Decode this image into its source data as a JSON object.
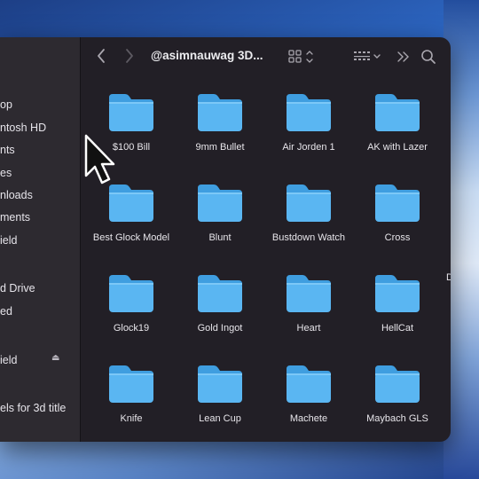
{
  "window": {
    "title": "@asimnauwag 3D..."
  },
  "sidebar": {
    "items": [
      {
        "label": "op"
      },
      {
        "label": "ntosh HD"
      },
      {
        "label": "nts"
      },
      {
        "label": "es"
      },
      {
        "label": "nloads"
      },
      {
        "label": "ments"
      },
      {
        "label": "ield"
      },
      {
        "label": "d Drive"
      },
      {
        "label": "ed"
      },
      {
        "label": "ield"
      },
      {
        "label": "els for 3d title"
      }
    ]
  },
  "toolbar": {
    "back_icon": "chevron-left-icon",
    "forward_icon": "chevron-right-icon",
    "view_icon": "grid-view-icon",
    "group_icon": "group-by-icon",
    "more_icon": "double-chevron-icon",
    "search_icon": "search-icon"
  },
  "folders": [
    {
      "label": "$100 Bill"
    },
    {
      "label": "9mm Bullet"
    },
    {
      "label": "Air Jorden 1"
    },
    {
      "label": "AK with Lazer"
    },
    {
      "label": "Best Glock Model"
    },
    {
      "label": "Blunt"
    },
    {
      "label": "Bustdown Watch"
    },
    {
      "label": "Cross"
    },
    {
      "label": "Glock19"
    },
    {
      "label": "Gold Ingot"
    },
    {
      "label": "Heart"
    },
    {
      "label": "HellCat"
    },
    {
      "label": "Knife"
    },
    {
      "label": "Lean Cup"
    },
    {
      "label": "Machete"
    },
    {
      "label": "Maybach GLS"
    }
  ],
  "peek_label": "D",
  "colors": {
    "folder_body": "#5ab6f2",
    "folder_tab": "#3f9ee0",
    "window_bg": "#221f26",
    "sidebar_bg": "#2d2a30"
  }
}
